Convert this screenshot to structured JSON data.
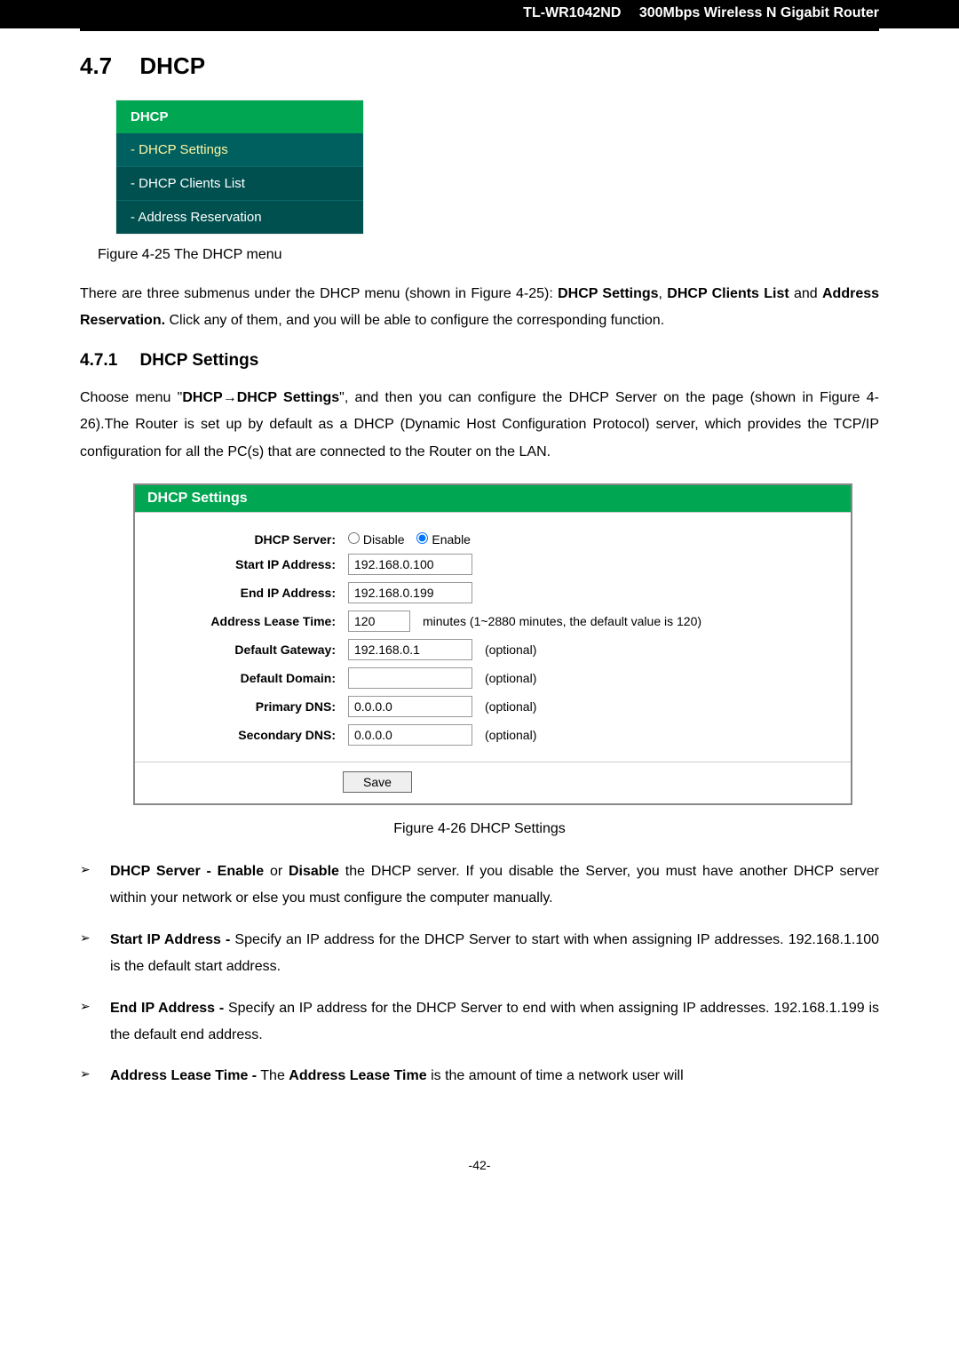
{
  "header": {
    "model": "TL-WR1042ND",
    "product": "300Mbps Wireless N Gigabit Router"
  },
  "section": {
    "num": "4.7",
    "title": "DHCP"
  },
  "menu": {
    "head": "DHCP",
    "selected": "- DHCP Settings",
    "items": [
      "- DHCP Clients List",
      "- Address Reservation"
    ]
  },
  "fig25": "Figure 4-25    The DHCP menu",
  "para1_parts": {
    "p1": "There are three submenus under the DHCP menu (shown in ",
    "fig_ref": "Figure 4-25",
    "p2": "): ",
    "b1": "DHCP Settings",
    "comma": ", ",
    "b2": "DHCP Clients List",
    "p3": " and ",
    "b3": "Address Reservation.",
    "p4": " Click any of them, and you will be able to configure the corresponding function."
  },
  "subsection": {
    "num": "4.7.1",
    "title": "DHCP Settings"
  },
  "para2_parts": {
    "p1": "Choose menu \"",
    "b1": "DHCP",
    "arrow": "→",
    "b2": "DHCP Settings",
    "p2": "\", and then you can configure the DHCP Server on the page (shown in ",
    "fig_ref": "Figure 4-26",
    "p3": ").The Router is set up by default as a DHCP (Dynamic Host Configuration Protocol) server, which provides the TCP/IP configuration for all the PC(s) that are connected to the Router on the LAN."
  },
  "panel": {
    "title": "DHCP Settings",
    "labels": {
      "server": "DHCP Server:",
      "start": "Start IP Address:",
      "end": "End IP Address:",
      "lease": "Address Lease Time:",
      "gateway": "Default Gateway:",
      "domain": "Default Domain:",
      "pdns": "Primary DNS:",
      "sdns": "Secondary DNS:"
    },
    "radio": {
      "disable": "Disable",
      "enable": "Enable"
    },
    "values": {
      "start": "192.168.0.100",
      "end": "192.168.0.199",
      "lease": "120",
      "gateway": "192.168.0.1",
      "domain": "",
      "pdns": "0.0.0.0",
      "sdns": "0.0.0.0"
    },
    "hints": {
      "lease": "minutes (1~2880 minutes, the default value is 120)",
      "optional": "(optional)"
    },
    "save": "Save"
  },
  "fig26": "Figure 4-26    DHCP Settings",
  "bullets": [
    {
      "b1": "DHCP Server - Enable",
      "t1": " or ",
      "b2": "Disable",
      "t2": " the DHCP server. If you disable the Server, you must have another DHCP server within your network or else you must configure the computer manually."
    },
    {
      "b1": "Start IP Address -",
      "t1": " Specify an IP address for the DHCP Server to start with when assigning IP addresses. 192.168.1.100 is the default start address."
    },
    {
      "b1": "End IP Address -",
      "t1": " Specify an IP address for the DHCP Server to end with when assigning IP addresses. 192.168.1.199 is the default end address."
    },
    {
      "b1": "Address Lease Time -",
      "t1": " The ",
      "b2": "Address Lease Time",
      "t2": " is the amount of time a network user will"
    }
  ],
  "page_num": "-42-"
}
